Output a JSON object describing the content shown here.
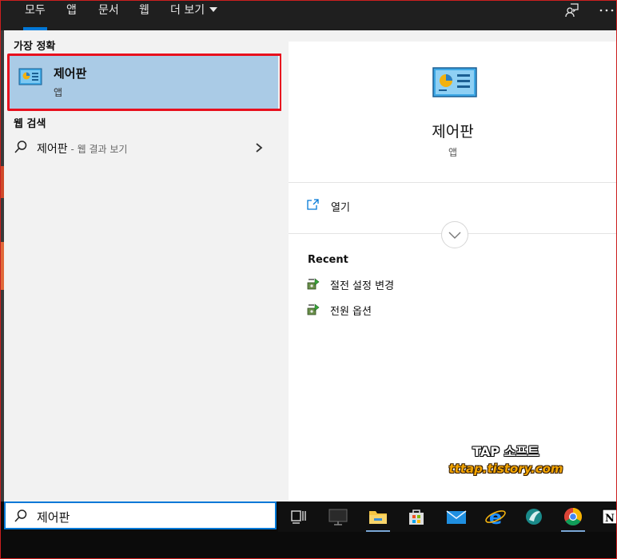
{
  "top_tabs": [
    {
      "label": "모두",
      "active": true
    },
    {
      "label": "앱",
      "active": false
    },
    {
      "label": "문서",
      "active": false
    },
    {
      "label": "웹",
      "active": false
    },
    {
      "label": "더 보기",
      "active": false,
      "has_dropdown": true
    }
  ],
  "top_icons": [
    "feedback-icon",
    "more-options-icon"
  ],
  "results": {
    "best_match_header": "가장 정확",
    "best_match": {
      "title": "제어판",
      "subtitle": "앱",
      "icon": "control-panel-icon"
    },
    "web_header": "웹 검색",
    "web_item": {
      "query": "제어판",
      "suffix": " - 웹 결과 보기"
    }
  },
  "preview": {
    "title": "제어판",
    "subtitle": "앱",
    "open_label": "열기",
    "recent_header": "Recent",
    "recent_items": [
      {
        "label": "절전 설정 변경",
        "icon": "power-options-icon"
      },
      {
        "label": "전원 옵션",
        "icon": "power-options-icon"
      }
    ]
  },
  "search": {
    "value": "제어판"
  },
  "taskbar": {
    "items": [
      "task-view-icon",
      "desktop-app-icon",
      "file-explorer-icon",
      "microsoft-store-icon",
      "mail-icon",
      "internet-explorer-icon",
      "app-icon",
      "chrome-icon",
      "notion-icon"
    ]
  },
  "watermark": {
    "line1": "TAP 소프트",
    "line2": "tttap.tistory.com"
  },
  "colors": {
    "accent": "#0078d7",
    "selection": "#aacbe6",
    "highlight_outline": "#e8101e",
    "watermark_orange": "#f2a400"
  }
}
